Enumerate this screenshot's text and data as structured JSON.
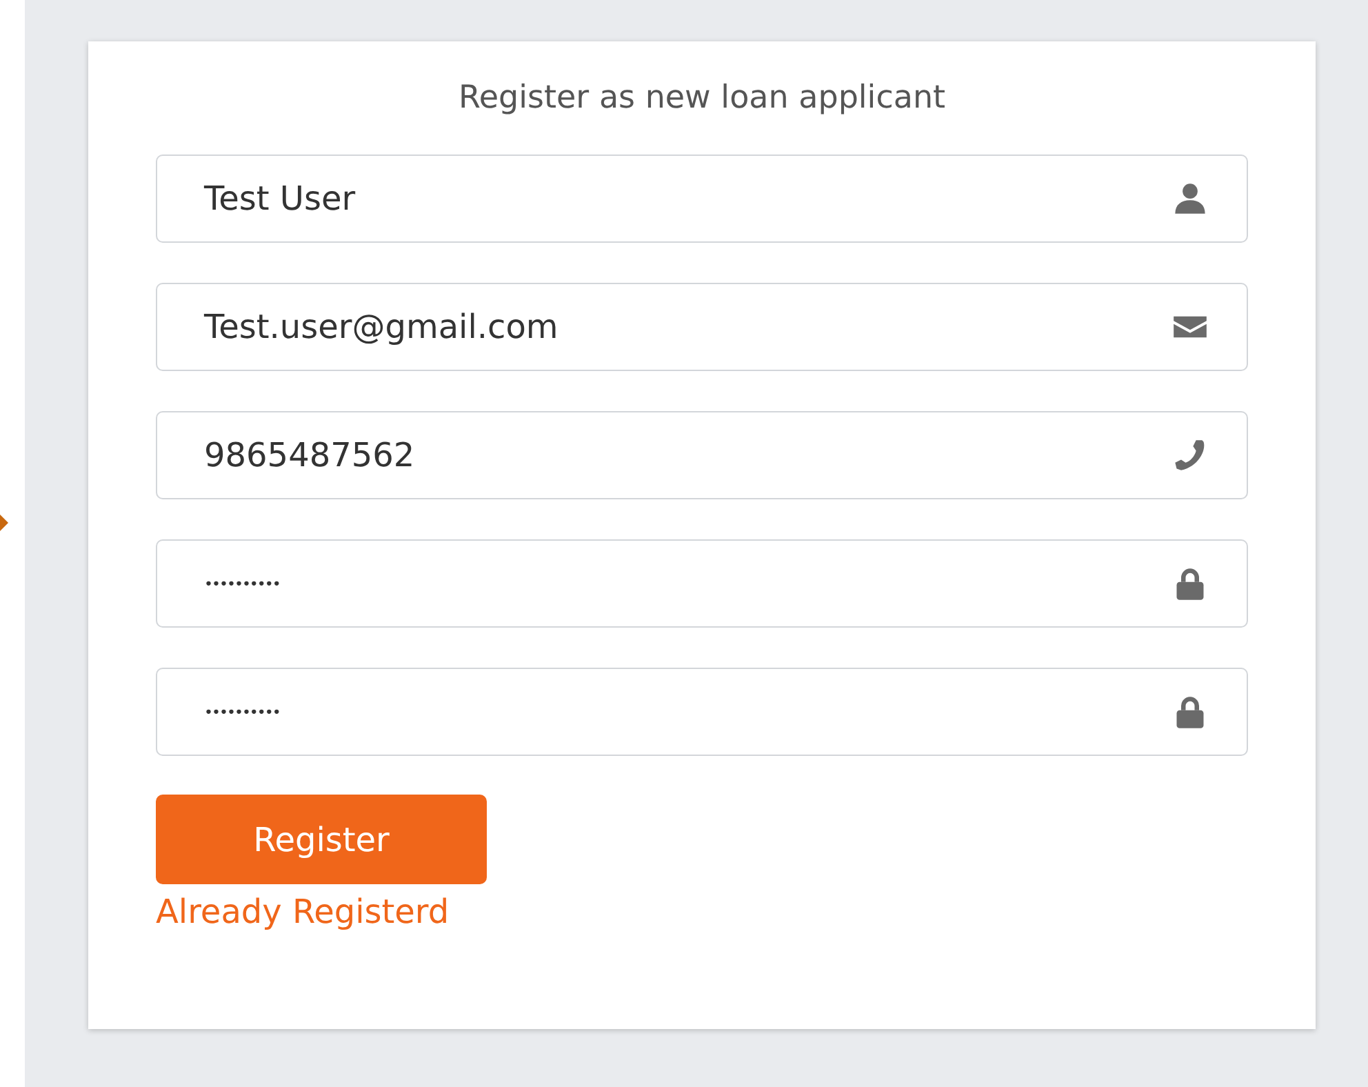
{
  "title": "Register as new loan applicant",
  "fields": [
    {
      "kind": "user",
      "value": "Test User"
    },
    {
      "kind": "email",
      "value": "Test.user@gmail.com"
    },
    {
      "kind": "phone",
      "value": "9865487562"
    },
    {
      "kind": "password",
      "value": "••••••••••"
    },
    {
      "kind": "password",
      "value": "••••••••••"
    }
  ],
  "button": "Register",
  "link": "Already Registerd"
}
